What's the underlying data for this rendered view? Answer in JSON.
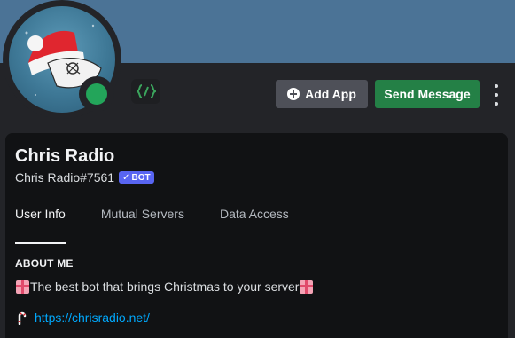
{
  "header": {
    "banner_color": "#4b7396",
    "status": "online",
    "status_color": "#23a55a",
    "badge_icon": "code-brackets-icon"
  },
  "actions": {
    "add_app_label": "Add App",
    "send_message_label": "Send Message",
    "more_icon": "vertical-dots-icon"
  },
  "profile": {
    "display_name": "Chris Radio",
    "username": "Chris Radio#7561",
    "bot_badge": "BOT"
  },
  "tabs": [
    {
      "label": "User Info",
      "active": true
    },
    {
      "label": "Mutual Servers",
      "active": false
    },
    {
      "label": "Data Access",
      "active": false
    }
  ],
  "about": {
    "title": "ABOUT ME",
    "text": "The best bot that brings Christmas to your server",
    "link": "https://chrisradio.net/"
  }
}
